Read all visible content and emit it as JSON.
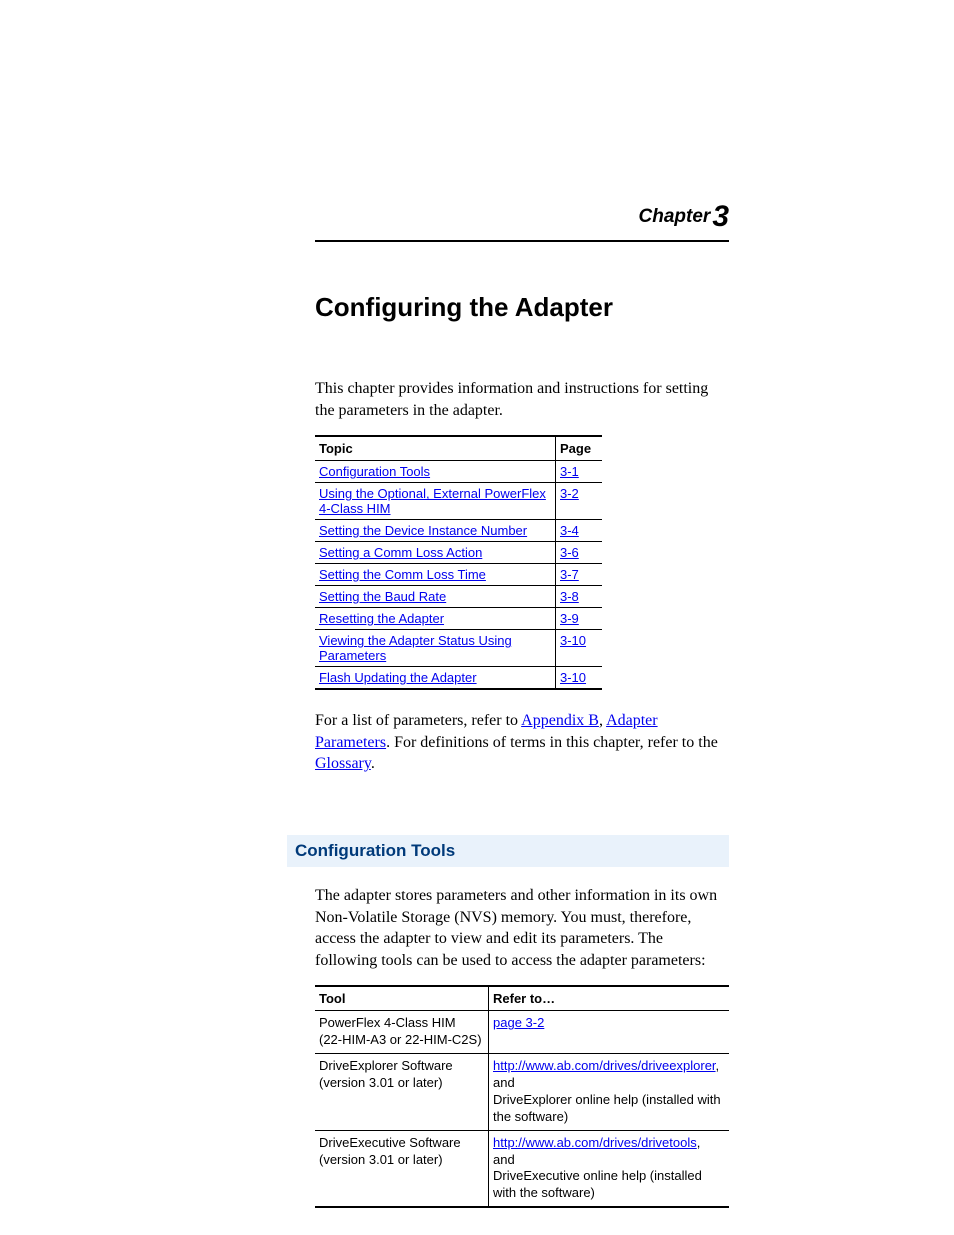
{
  "chapter": {
    "word": "Chapter",
    "num": "3"
  },
  "title": "Configuring the Adapter",
  "intro": "This chapter provides information and instructions for setting the parameters in the adapter.",
  "topic_table": {
    "headers": {
      "topic": "Topic",
      "page": "Page"
    },
    "rows": [
      {
        "topic": "Configuration Tools",
        "page": "3-1"
      },
      {
        "topic": "Using the Optional, External PowerFlex 4-Class HIM",
        "page": "3-2"
      },
      {
        "topic": "Setting the Device Instance Number",
        "page": "3-4"
      },
      {
        "topic": "Setting a Comm Loss Action",
        "page": "3-6"
      },
      {
        "topic": "Setting the Comm Loss Time",
        "page": "3-7"
      },
      {
        "topic": "Setting the Baud Rate",
        "page": "3-8"
      },
      {
        "topic": "Resetting the Adapter",
        "page": "3-9"
      },
      {
        "topic": "Viewing the Adapter Status Using Parameters",
        "page": "3-10"
      },
      {
        "topic": "Flash Updating the Adapter",
        "page": "3-10"
      }
    ]
  },
  "refs_para": {
    "pre": "For a list of parameters, refer to ",
    "appendix": "Appendix B",
    "sep1": ", ",
    "adapter_params": "Adapter Parameters",
    "mid": ". For definitions of terms in this chapter, refer to the ",
    "glossary": "Glossary",
    "end": "."
  },
  "section_heading": "Configuration Tools",
  "section_para": "The adapter stores parameters and other information in its own Non-Volatile Storage (NVS) memory. You must, therefore, access the adapter to view and edit its parameters. The following tools can be used to access the adapter parameters:",
  "tools_table": {
    "headers": {
      "tool": "Tool",
      "refer": "Refer to…"
    },
    "rows": [
      {
        "tool_line1": "PowerFlex 4-Class HIM",
        "tool_line2": "(22-HIM-A3 or 22-HIM-C2S)",
        "link": "page 3-2",
        "after": ""
      },
      {
        "tool_line1": "DriveExplorer Software",
        "tool_line2": "(version 3.01 or later)",
        "link": "http://www.ab.com/drives/driveexplorer",
        "after_link": ", and",
        "line2": "DriveExplorer online help (installed with the software)"
      },
      {
        "tool_line1": "DriveExecutive Software",
        "tool_line2": "(version 3.01 or later)",
        "link": "http://www.ab.com/drives/drivetools",
        "after_link": ", and",
        "line2": "DriveExecutive online help (installed with the software)"
      }
    ]
  }
}
